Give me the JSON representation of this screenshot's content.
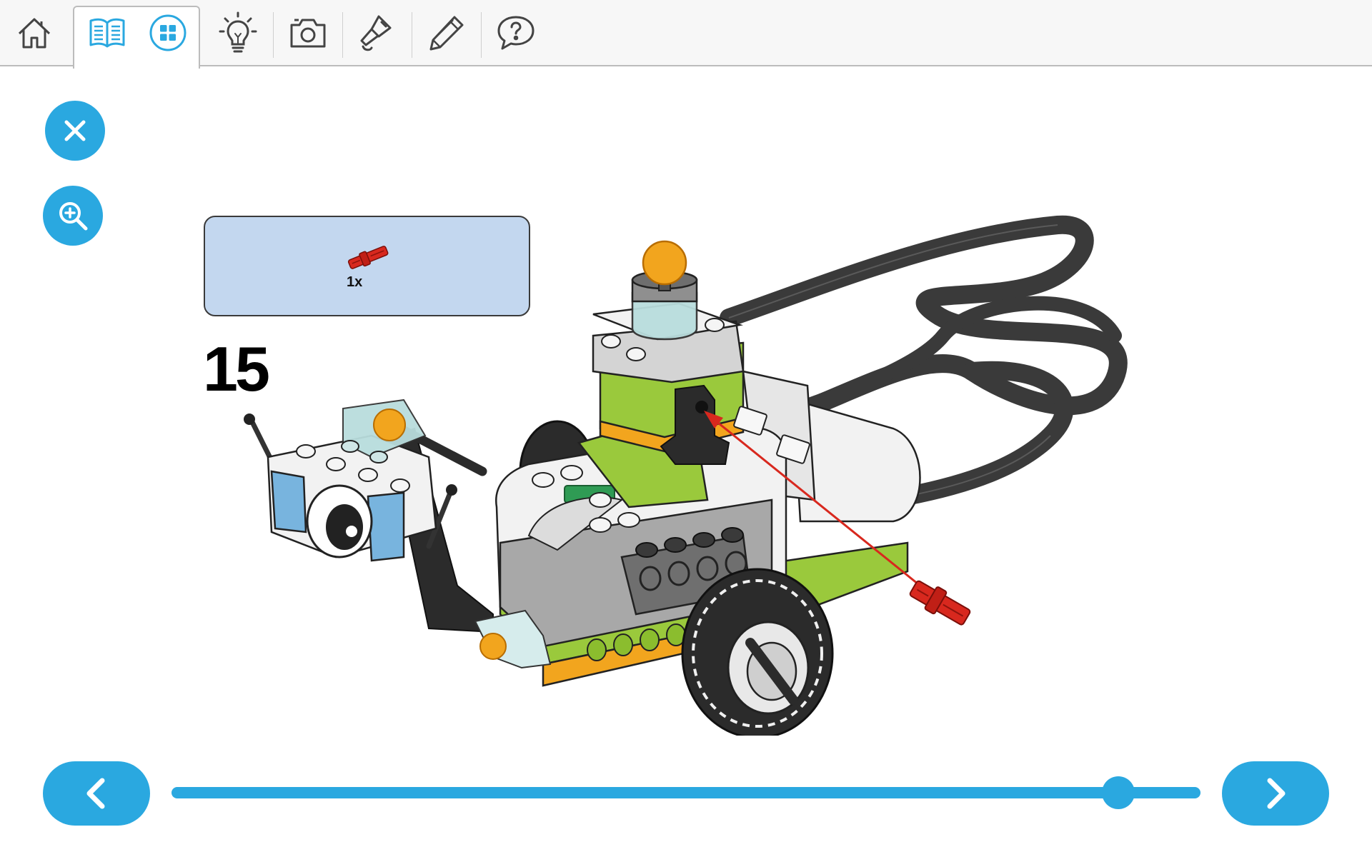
{
  "toolbar": {
    "items": [
      {
        "name": "home-icon"
      },
      {
        "name": "building-instructions-icon"
      },
      {
        "name": "grid-overview-icon"
      },
      {
        "name": "lightbulb-icon"
      },
      {
        "name": "camera-icon"
      },
      {
        "name": "microphone-icon"
      },
      {
        "name": "pencil-icon"
      },
      {
        "name": "help-speech-icon"
      }
    ]
  },
  "instructions": {
    "parts_quantity": "1x",
    "step_number": "15",
    "slider": {
      "current_fraction": 0.92
    }
  },
  "colors": {
    "accent": "#2aa8e0",
    "parts_box": "#c3d7ef",
    "brick_lime": "#9ac93c",
    "brick_orange": "#f2a51e",
    "brick_white": "#f2f2f2",
    "brick_gray": "#a8a8a8",
    "brick_black": "#2b2b2b",
    "pin_red": "#d8281e",
    "sensor_blue": "#78b4de"
  }
}
